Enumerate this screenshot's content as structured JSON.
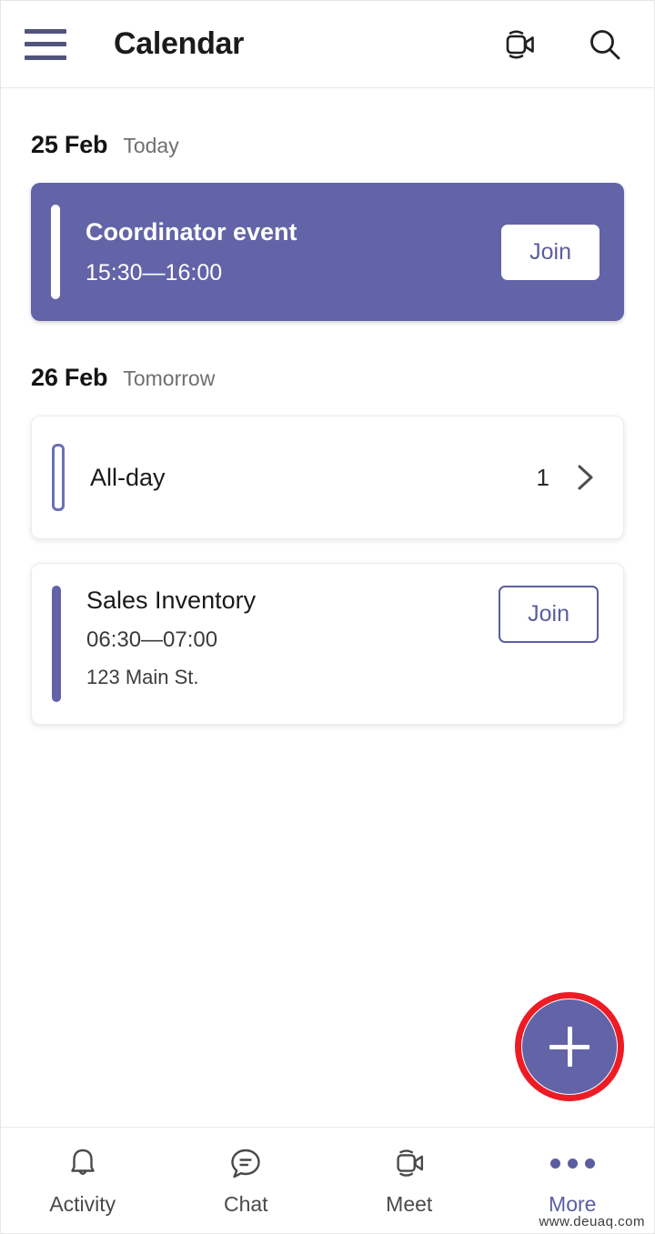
{
  "header": {
    "title": "Calendar",
    "menu_icon": "hamburger-menu-icon",
    "meet_now_icon": "video-camera-icon",
    "search_icon": "search-icon"
  },
  "days": [
    {
      "date": "25 Feb",
      "relative": "Today",
      "events": [
        {
          "kind": "meeting",
          "style": "filled",
          "title": "Coordinator event",
          "time": "15:30—16:00",
          "location": "",
          "join_label": "Join",
          "accent_color": "#ffffff"
        }
      ]
    },
    {
      "date": "26 Feb",
      "relative": "Tomorrow",
      "events": [
        {
          "kind": "all-day",
          "style": "outlined",
          "title": "All-day",
          "count": "1",
          "chevron_icon": "chevron-right-icon",
          "accent_color": "#6d70b4"
        },
        {
          "kind": "meeting",
          "style": "outlined",
          "title": "Sales Inventory",
          "time": "06:30—07:00",
          "location": "123 Main St.",
          "join_label": "Join",
          "accent_color": "#6264a7"
        }
      ]
    }
  ],
  "fab": {
    "icon": "plus-icon",
    "highlight_color": "#ed1c24",
    "background_color": "#6264a7"
  },
  "bottom_nav": {
    "items": [
      {
        "label": "Activity",
        "icon": "bell-icon",
        "active": false
      },
      {
        "label": "Chat",
        "icon": "chat-bubble-icon",
        "active": false
      },
      {
        "label": "Meet",
        "icon": "video-camera-icon",
        "active": false
      },
      {
        "label": "More",
        "icon": "ellipsis-icon",
        "active": true
      }
    ],
    "active_color": "#5b5e9e"
  },
  "watermark": "www.deuaq.com",
  "theme": {
    "brand_purple": "#6264a7",
    "accent_purple": "#5b5e9e",
    "text_primary": "#1a1a1a",
    "text_secondary": "#6f6f6f"
  }
}
